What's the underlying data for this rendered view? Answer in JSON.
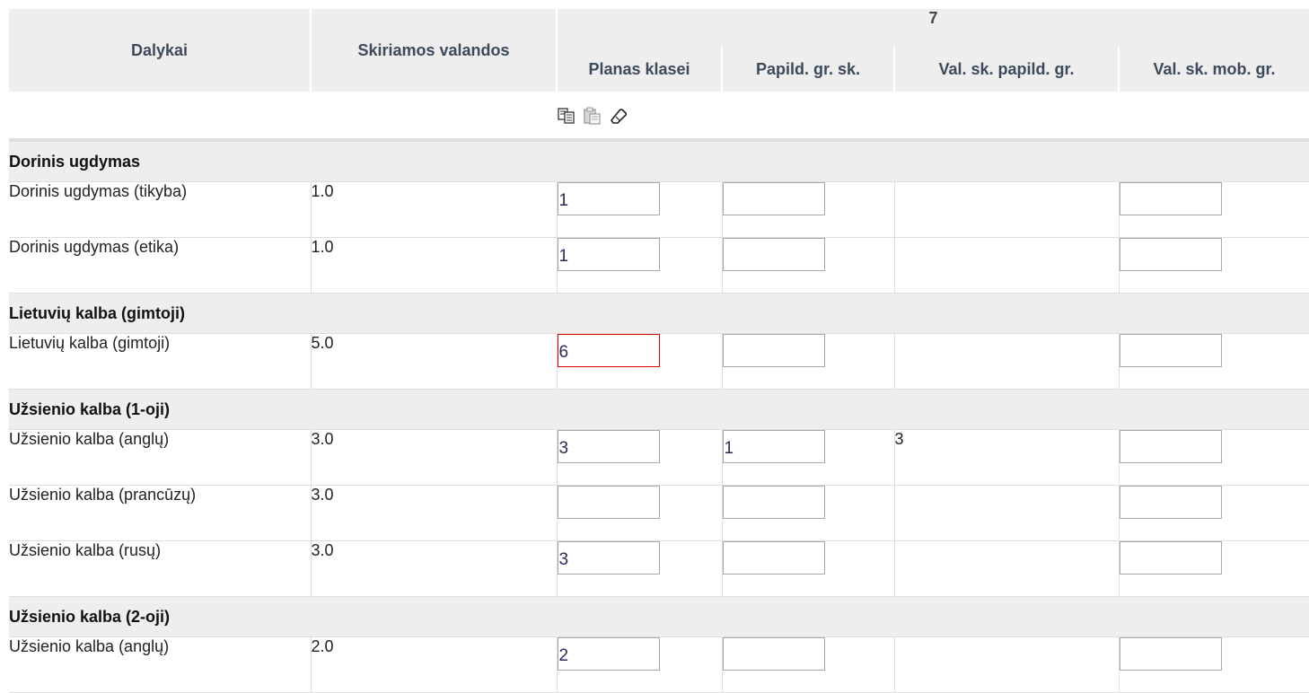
{
  "header": {
    "col_subjects": "Dalykai",
    "col_hours": "Skiriamos valandos",
    "grade": "7",
    "sub_columns": [
      "Planas klasei",
      "Papild. gr. sk.",
      "Val. sk. papild. gr.",
      "Val. sk. mob. gr."
    ]
  },
  "toolbar": {
    "icons": [
      "copy-icon",
      "paste-icon",
      "eraser-icon"
    ]
  },
  "groups": [
    {
      "title": "Dorinis ugdymas",
      "rows": [
        {
          "name": "Dorinis ugdymas (tikyba)",
          "hours": "1.0",
          "plan": "1",
          "extra_groups": "",
          "extra_hours": "",
          "mob_hours": ""
        },
        {
          "name": "Dorinis ugdymas (etika)",
          "hours": "1.0",
          "plan": "1",
          "extra_groups": "",
          "extra_hours": "",
          "mob_hours": ""
        }
      ]
    },
    {
      "title": "Lietuvių kalba (gimtoji)",
      "rows": [
        {
          "name": "Lietuvių kalba (gimtoji)",
          "hours": "5.0",
          "plan": "6",
          "extra_groups": "",
          "extra_hours": "",
          "mob_hours": "",
          "invalid": true
        }
      ]
    },
    {
      "title": "Užsienio kalba (1-oji)",
      "rows": [
        {
          "name": "Užsienio kalba (anglų)",
          "hours": "3.0",
          "plan": "3",
          "extra_groups": "1",
          "extra_hours": "3",
          "mob_hours": ""
        },
        {
          "name": "Užsienio kalba (prancūzų)",
          "hours": "3.0",
          "plan": "",
          "extra_groups": "",
          "extra_hours": "",
          "mob_hours": ""
        },
        {
          "name": "Užsienio kalba (rusų)",
          "hours": "3.0",
          "plan": "3",
          "extra_groups": "",
          "extra_hours": "",
          "mob_hours": ""
        }
      ]
    },
    {
      "title": "Užsienio kalba (2-oji)",
      "rows": [
        {
          "name": "Užsienio kalba (anglų)",
          "hours": "2.0",
          "plan": "2",
          "extra_groups": "",
          "extra_hours": "",
          "mob_hours": "",
          "focused": true
        }
      ]
    }
  ]
}
